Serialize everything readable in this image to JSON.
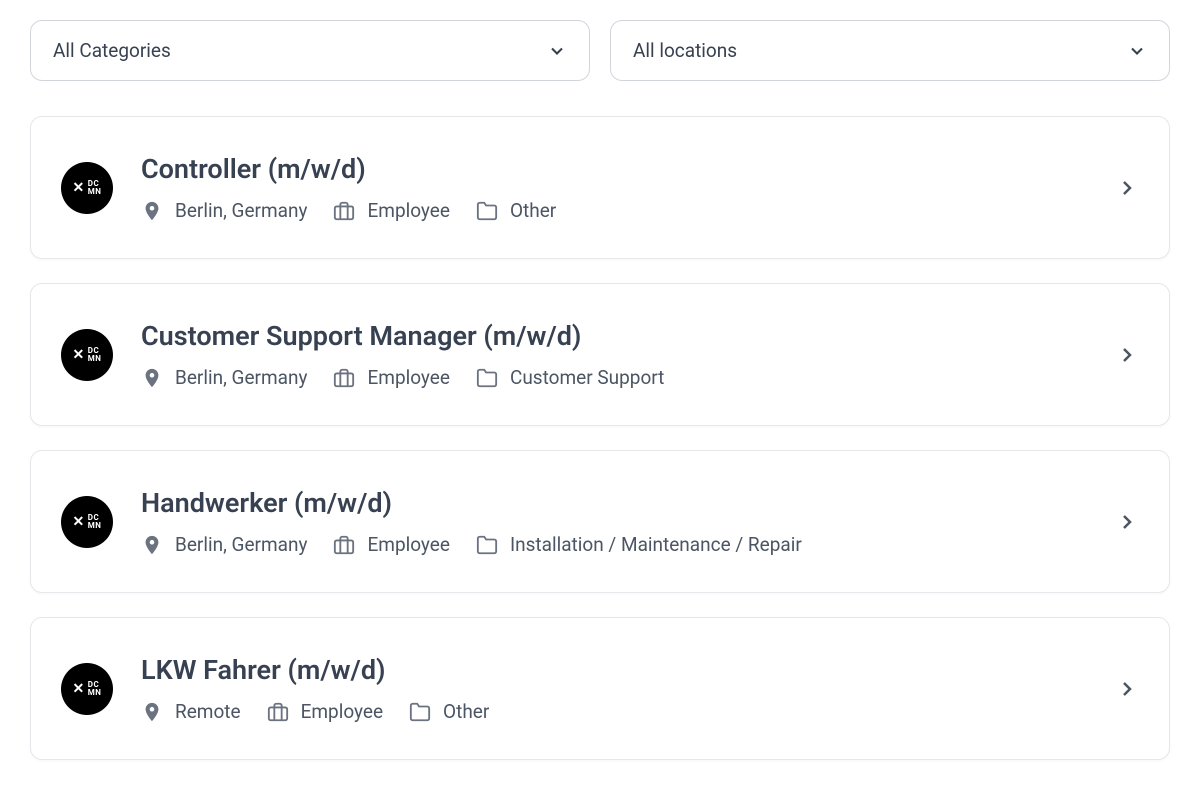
{
  "filters": {
    "category": "All Categories",
    "location": "All locations"
  },
  "jobs": [
    {
      "title": "Controller (m/w/d)",
      "location": "Berlin, Germany",
      "type": "Employee",
      "category": "Other"
    },
    {
      "title": "Customer Support Manager (m/w/d)",
      "location": "Berlin, Germany",
      "type": "Employee",
      "category": "Customer Support"
    },
    {
      "title": "Handwerker (m/w/d)",
      "location": "Berlin, Germany",
      "type": "Employee",
      "category": "Installation / Maintenance / Repair"
    },
    {
      "title": "LKW Fahrer (m/w/d)",
      "location": "Remote",
      "type": "Employee",
      "category": "Other"
    }
  ],
  "logo": {
    "line1": "DC",
    "line2": "MN"
  }
}
